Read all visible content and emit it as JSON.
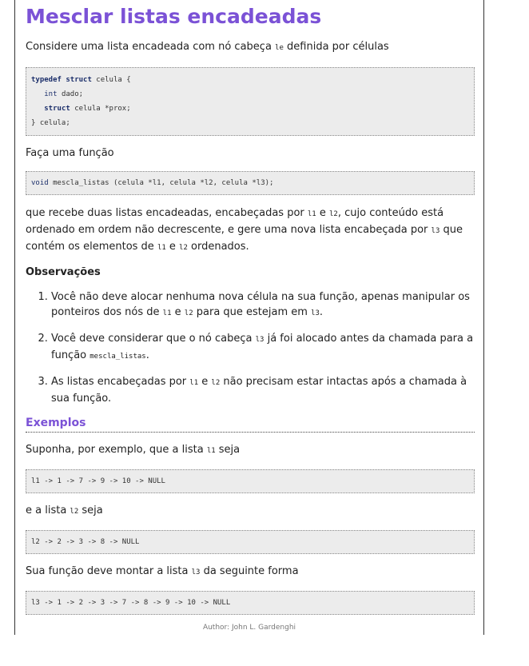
{
  "title": "Mesclar listas encadeadas",
  "intro": {
    "text_before": "Considere uma lista encadeada com nó cabeça ",
    "code": "le",
    "text_after": " definida por células"
  },
  "struct_code": {
    "line1_kw1": "typedef",
    "line1_kw2": "struct",
    "line1_rest": " celula {",
    "line2_type": "int",
    "line2_rest": " dado;",
    "line3_kw": "struct",
    "line3_rest": " celula *prox;",
    "line4": "} celula;"
  },
  "func_intro": "Faça uma função",
  "func_code": {
    "type": "void",
    "rest": " mescla_listas (celula *l1, celula *l2, celula *l3);"
  },
  "description": {
    "t1": "que recebe duas listas encadeadas, encabeçadas por ",
    "c1": "l1",
    "t2": " e ",
    "c2": "l2",
    "t3": ", cujo conteúdo está ordenado em ordem não decrescente, e gere uma nova lista encabeçada por ",
    "c3": "l3",
    "t4": " que contém os elementos de ",
    "c4": "l1",
    "t5": " e ",
    "c5": "l2",
    "t6": " ordenados."
  },
  "observations": {
    "title": "Observações",
    "item1": {
      "t1": "Você não deve alocar nenhuma nova célula na sua função, apenas manipular os ponteiros dos nós de ",
      "c1": "l1",
      "t2": " e ",
      "c2": "l2",
      "t3": " para que estejam em ",
      "c3": "l3",
      "t4": "."
    },
    "item2": {
      "t1": "Você deve considerar que o nó cabeça ",
      "c1": "l3",
      "t2": " já foi alocado antes da chamada para a função ",
      "c2": "mescla_listas",
      "t3": "."
    },
    "item3": {
      "t1": "As listas encabeçadas por ",
      "c1": "l1",
      "t2": " e ",
      "c2": "l2",
      "t3": " não precisam estar intactas após a chamada à sua função."
    }
  },
  "examples": {
    "title": "Exemplos",
    "ex1_t1": "Suponha, por exemplo, que a lista ",
    "ex1_c": "l1",
    "ex1_t2": " seja",
    "ex1_code": "l1 -> 1 -> 7 -> 9 -> 10 -> NULL",
    "ex2_t1": "e a lista ",
    "ex2_c": "l2",
    "ex2_t2": " seja",
    "ex2_code": "l2 -> 2 -> 3 -> 8 -> NULL",
    "ex3_t1": "Sua função deve montar a lista ",
    "ex3_c": "l3",
    "ex3_t2": " da seguinte forma",
    "ex3_code": "l3 -> 1 -> 2 -> 3 -> 7 -> 8 -> 9 -> 10 -> NULL"
  },
  "footer": "Author: John L. Gardenghi"
}
